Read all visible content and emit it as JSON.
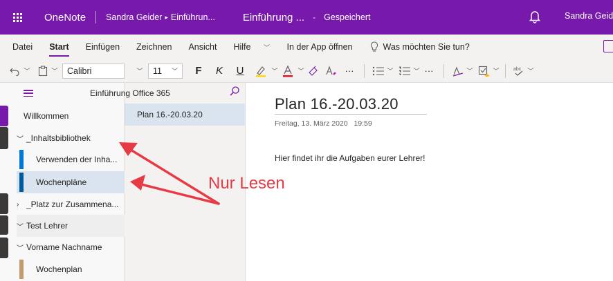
{
  "topbar": {
    "app_name": "OneNote",
    "breadcrumb_user": "Sandra Geider",
    "breadcrumb_notebook": "Einführun...",
    "doc_title": "Einführung ...",
    "separator": "-",
    "status": "Gespeichert",
    "user_name": "Sandra Geide",
    "background": "#7719aa"
  },
  "menu": {
    "items": [
      "Datei",
      "Start",
      "Einfügen",
      "Zeichnen",
      "Ansicht",
      "Hilfe"
    ],
    "active": "Start",
    "open_in_app": "In der App öffnen",
    "tell_me": "Was möchten Sie tun?"
  },
  "toolbar": {
    "font_name": "Calibri",
    "font_size": "11",
    "bold": "F",
    "italic": "K",
    "underline": "U",
    "more": "···",
    "highlight_color": "#ffd800",
    "font_color": "#e81123"
  },
  "notebook": {
    "title": "Einführung Office 365"
  },
  "sections": [
    {
      "label": "Willkommen",
      "type": "leaf",
      "color": "#7719aa"
    },
    {
      "label": "_Inhaltsbibliothek",
      "type": "group",
      "caret": "expanded"
    },
    {
      "label": "Verwenden der Inha...",
      "type": "child",
      "color": "#0078d4"
    },
    {
      "label": "Wochenpläne",
      "type": "child",
      "color": "#005a9e",
      "selected": true
    },
    {
      "label": "_Platz zur Zusammena...",
      "type": "group",
      "caret": "collapsed"
    },
    {
      "label": "Test Lehrer",
      "type": "group",
      "caret": "expanded"
    },
    {
      "label": "Vorname Nachname",
      "type": "group",
      "caret": "expanded"
    },
    {
      "label": "Wochenplan",
      "type": "child",
      "color": "#c19c6e"
    }
  ],
  "pages": [
    {
      "label": "Plan 16.-20.03.20",
      "selected": true
    }
  ],
  "content": {
    "title": "Plan 16.-20.03.20",
    "date": "Freitag, 13. März 2020",
    "time": "19:59",
    "body": "Hier findet ihr die Aufgaben eurer Lehrer!"
  },
  "annotation": {
    "text": "Nur Lesen",
    "color": "#e83a45"
  }
}
